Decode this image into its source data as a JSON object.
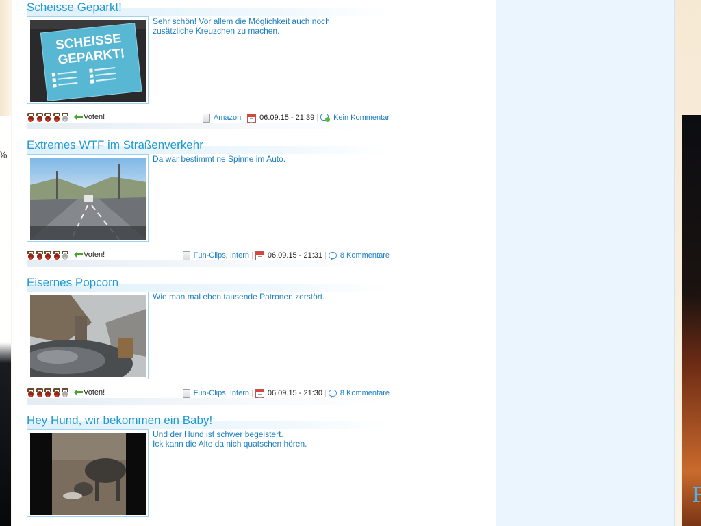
{
  "background": {
    "left_fragment": "%",
    "right_fragment": "F"
  },
  "posts": [
    {
      "title": "Scheisse Geparkt!",
      "text": [
        "Sehr schön! Vor allem die Möglichkeit auch noch zusätzliche Kreuzchen zu machen."
      ],
      "thumb_text": [
        "SCHEISSE",
        "GEPARKT!"
      ],
      "vote_label": "Voten!",
      "categories": [
        "Amazon"
      ],
      "date": "06.09.15 - 21:39",
      "comments": "Kein Kommentar"
    },
    {
      "title": "Extremes WTF im Straßenverkehr",
      "text": [
        "Da war bestimmt ne Spinne im Auto."
      ],
      "vote_label": "Voten!",
      "categories": [
        "Fun-Clips",
        "Intern"
      ],
      "date": "06.09.15 - 21:31",
      "comments": "8 Kommentare"
    },
    {
      "title": "Eisernes Popcorn",
      "text": [
        "Wie man mal eben tausende Patronen zerstört."
      ],
      "vote_label": "Voten!",
      "categories": [
        "Fun-Clips",
        "Intern"
      ],
      "date": "06.09.15 - 21:30",
      "comments": "8 Kommentare"
    },
    {
      "title": "Hey Hund, wir bekommen ein Baby!",
      "text": [
        "Und der Hund ist schwer begeistert.",
        "Ick kann die Alte da nich quatschen hören."
      ]
    }
  ],
  "category_separator": ","
}
